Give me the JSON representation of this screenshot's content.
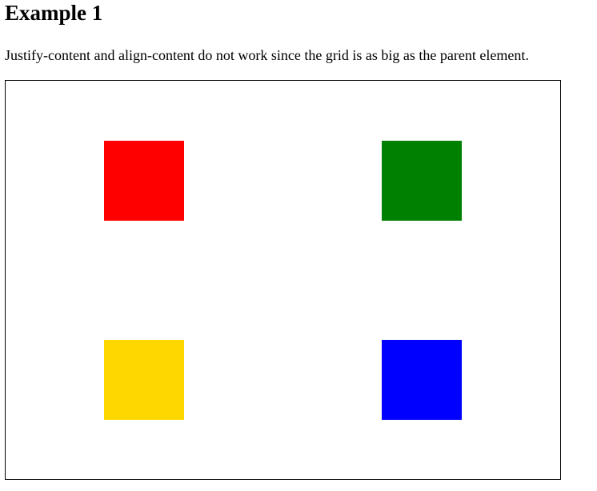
{
  "heading": "Example 1",
  "description": "Justify-content and align-content do not work since the grid is as big as the parent element.",
  "grid": {
    "items": [
      {
        "name": "red-square",
        "color": "#ff0000"
      },
      {
        "name": "green-square",
        "color": "#008000"
      },
      {
        "name": "gold-square",
        "color": "#ffd700"
      },
      {
        "name": "blue-square",
        "color": "#0000ff"
      }
    ]
  }
}
